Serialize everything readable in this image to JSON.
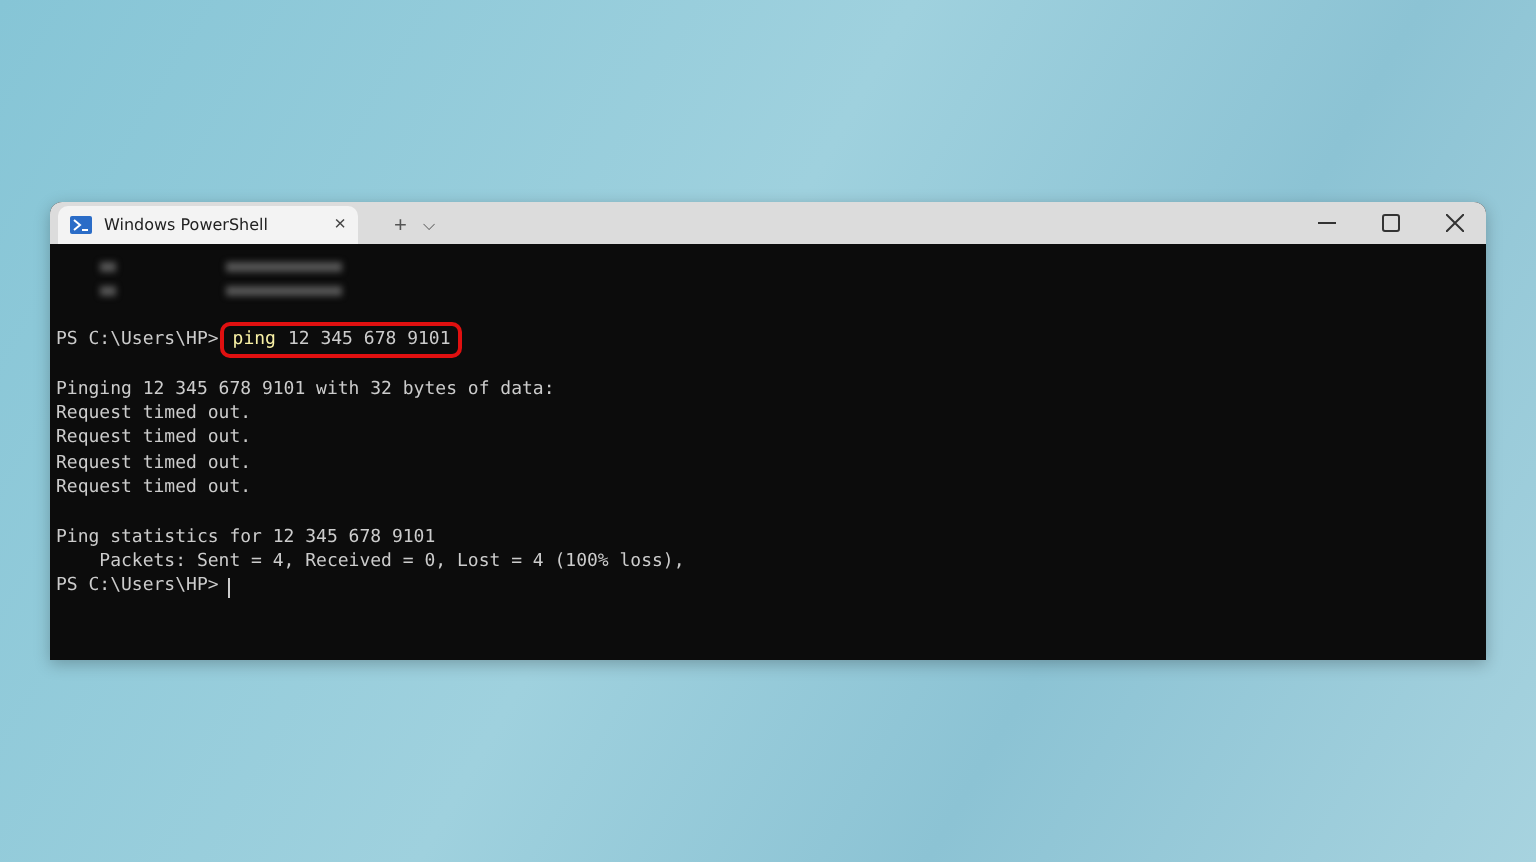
{
  "window": {
    "tab_title": "Windows PowerShell",
    "tab_close": "×",
    "new_tab": "+",
    "dropdown": "⌵"
  },
  "terminal": {
    "lines": [
      {
        "kind": "blurred"
      },
      {
        "kind": "blurred"
      },
      {
        "kind": "blank"
      },
      {
        "kind": "command",
        "prompt": "PS C:\\Users\\HP>",
        "command": "ping",
        "args": "12 345 678 9101",
        "highlighted": true
      },
      {
        "kind": "blank"
      },
      {
        "kind": "output",
        "text": "Pinging 12 345 678 9101 with 32 bytes of data:"
      },
      {
        "kind": "output",
        "text": "Request timed out."
      },
      {
        "kind": "output",
        "text": "Request timed out."
      },
      {
        "kind": "output",
        "text": "Request timed out."
      },
      {
        "kind": "output",
        "text": "Request timed out."
      },
      {
        "kind": "blank"
      },
      {
        "kind": "output",
        "text": "Ping statistics for 12 345 678 9101"
      },
      {
        "kind": "output",
        "text": "    Packets: Sent = 4, Received = 0, Lost = 4 (100% loss),"
      },
      {
        "kind": "cursor",
        "prompt": "PS C:\\Users\\HP>"
      }
    ]
  }
}
